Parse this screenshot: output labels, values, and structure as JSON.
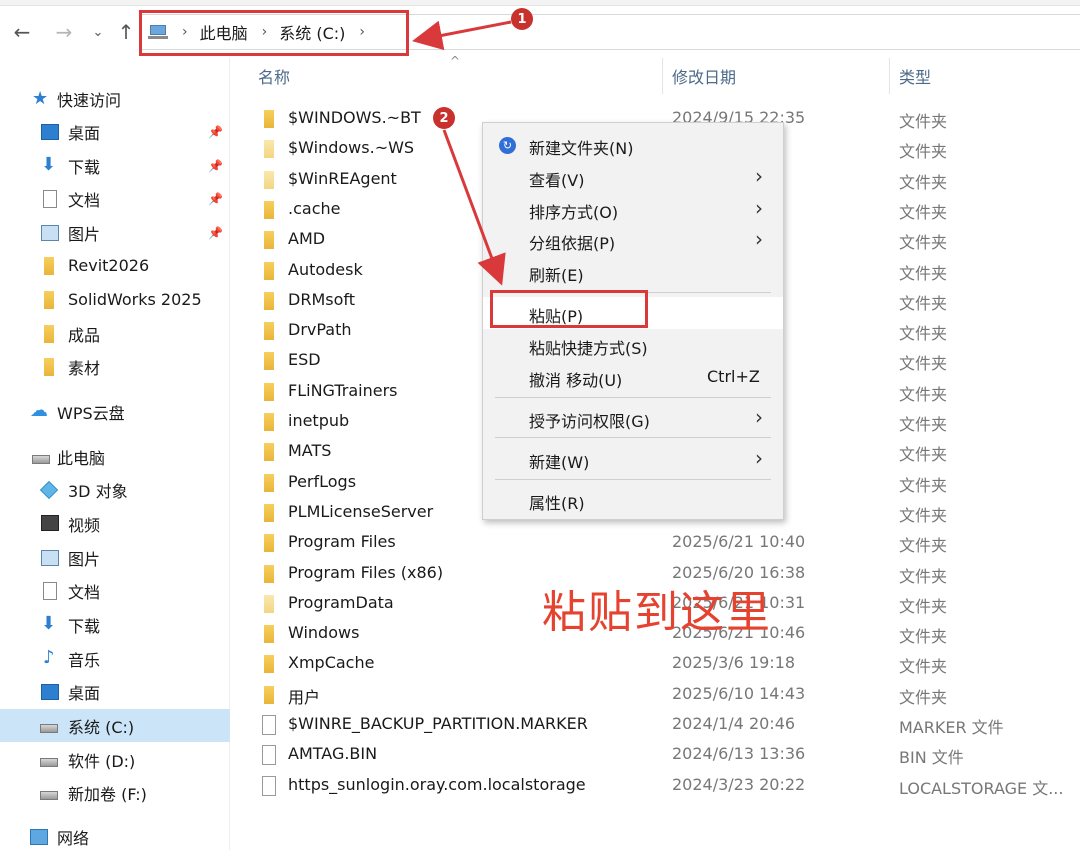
{
  "breadcrumb": {
    "items": [
      "此电脑",
      "系统 (C:)"
    ]
  },
  "badges": [
    "1",
    "2"
  ],
  "sidebar": {
    "quick_access": "快速访问",
    "items": [
      {
        "label": "桌面",
        "icon": "desktop-icon",
        "pinned": true
      },
      {
        "label": "下载",
        "icon": "download-icon",
        "pinned": true
      },
      {
        "label": "文档",
        "icon": "document-icon",
        "pinned": true
      },
      {
        "label": "图片",
        "icon": "picture-icon",
        "pinned": true
      },
      {
        "label": "Revit2026",
        "icon": "folder-icon"
      },
      {
        "label": "SolidWorks 2025",
        "icon": "folder-icon"
      },
      {
        "label": "成品",
        "icon": "folder-icon"
      },
      {
        "label": "素材",
        "icon": "folder-icon"
      }
    ],
    "wps": "WPS云盘",
    "this_pc": "此电脑",
    "pc_items": [
      {
        "label": "3D 对象",
        "icon": "3d-objects-icon"
      },
      {
        "label": "视频",
        "icon": "video-icon"
      },
      {
        "label": "图片",
        "icon": "picture-icon"
      },
      {
        "label": "文档",
        "icon": "document-icon"
      },
      {
        "label": "下载",
        "icon": "download-icon"
      },
      {
        "label": "音乐",
        "icon": "music-icon"
      },
      {
        "label": "桌面",
        "icon": "desktop-icon"
      },
      {
        "label": "系统 (C:)",
        "icon": "drive-icon",
        "selected": true
      },
      {
        "label": "软件 (D:)",
        "icon": "drive-icon"
      },
      {
        "label": "新加卷 (F:)",
        "icon": "drive-icon"
      }
    ],
    "network": "网络"
  },
  "columns": {
    "name": "名称",
    "date": "修改日期",
    "type": "类型"
  },
  "files": [
    {
      "name": "$WINDOWS.~BT",
      "date": "2024/9/15 22:35",
      "type": "文件夹",
      "kind": "folder"
    },
    {
      "name": "$Windows.~WS",
      "date": "39",
      "type": "文件夹",
      "kind": "folder-light"
    },
    {
      "name": "$WinREAgent",
      "date": "9",
      "type": "文件夹",
      "kind": "folder-light"
    },
    {
      "name": ".cache",
      "date": "13",
      "type": "文件夹",
      "kind": "folder"
    },
    {
      "name": "AMD",
      "date": "7",
      "type": "文件夹",
      "kind": "folder"
    },
    {
      "name": "Autodesk",
      "date": "43",
      "type": "文件夹",
      "kind": "folder"
    },
    {
      "name": "DRMsoft",
      "date": "15",
      "type": "文件夹",
      "kind": "folder"
    },
    {
      "name": "DrvPath",
      "date": "4",
      "type": "文件夹",
      "kind": "folder"
    },
    {
      "name": "ESD",
      "date": "05",
      "type": "文件夹",
      "kind": "folder"
    },
    {
      "name": "FLiNGTrainers",
      "date": "4",
      "type": "文件夹",
      "kind": "folder"
    },
    {
      "name": "inetpub",
      "date": "9",
      "type": "文件夹",
      "kind": "folder"
    },
    {
      "name": "MATS",
      "date": "11",
      "type": "文件夹",
      "kind": "folder"
    },
    {
      "name": "PerfLogs",
      "date": "14",
      "type": "文件夹",
      "kind": "folder"
    },
    {
      "name": "PLMLicenseServer",
      "date": "44",
      "type": "文件夹",
      "kind": "folder"
    },
    {
      "name": "Program Files",
      "date": "2025/6/21 10:40",
      "type": "文件夹",
      "kind": "folder"
    },
    {
      "name": "Program Files (x86)",
      "date": "2025/6/20 16:38",
      "type": "文件夹",
      "kind": "folder"
    },
    {
      "name": "ProgramData",
      "date": "2025/6/21 10:31",
      "type": "文件夹",
      "kind": "folder-light"
    },
    {
      "name": "Windows",
      "date": "2025/6/21 10:46",
      "type": "文件夹",
      "kind": "folder"
    },
    {
      "name": "XmpCache",
      "date": "2025/3/6 19:18",
      "type": "文件夹",
      "kind": "folder"
    },
    {
      "name": "用户",
      "date": "2025/6/10 14:43",
      "type": "文件夹",
      "kind": "folder"
    },
    {
      "name": "$WINRE_BACKUP_PARTITION.MARKER",
      "date": "2024/1/4 20:46",
      "type": "MARKER 文件",
      "kind": "file"
    },
    {
      "name": "AMTAG.BIN",
      "date": "2024/6/13 13:36",
      "type": "BIN 文件",
      "kind": "file"
    },
    {
      "name": "https_sunlogin.oray.com.localstorage",
      "date": "2024/3/23 20:22",
      "type": "LOCALSTORAGE 文...",
      "kind": "file"
    }
  ],
  "context_menu": [
    {
      "label": "新建文件夹(N)",
      "icon": "new-folder-icon"
    },
    {
      "label": "查看(V)",
      "submenu": true
    },
    {
      "label": "排序方式(O)",
      "submenu": true
    },
    {
      "label": "分组依据(P)",
      "submenu": true
    },
    {
      "label": "刷新(E)"
    },
    {
      "label": "粘贴(P)",
      "hover": true
    },
    {
      "label": "粘贴快捷方式(S)"
    },
    {
      "label": "撤消 移动(U)",
      "shortcut": "Ctrl+Z"
    },
    {
      "label": "授予访问权限(G)",
      "submenu": true
    },
    {
      "label": "新建(W)",
      "submenu": true
    },
    {
      "label": "属性(R)"
    }
  ],
  "annotation_text": "粘贴到这里",
  "colors": {
    "annotation": "#d9393a",
    "selected": "#cce4f7",
    "accent": "#2f7fd1"
  }
}
